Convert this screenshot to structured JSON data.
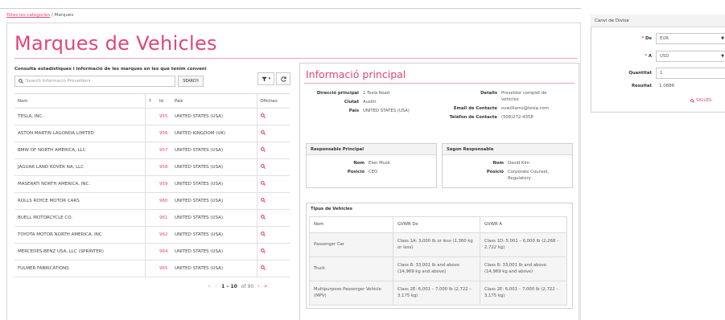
{
  "breadcrumb": {
    "root": "Totes les categories",
    "sep": " / ",
    "current": "Marques"
  },
  "page_title": "Marques de Vehicles",
  "list": {
    "subtitle": "Consulta estadístiques i informació de les marques en les que tenim conveni",
    "search_placeholder": "Search Informació Proveïdors",
    "search_button": "SEARCH",
    "filter_label": "▾",
    "columns": {
      "name": "Nom",
      "sort": "↑",
      "id": "Id",
      "country": "País",
      "offices": "Oficines"
    },
    "rows": [
      {
        "name": "TESLA, INC.",
        "id": "955",
        "country": "UNITED STATES (USA)"
      },
      {
        "name": "ASTON MARTIN LAGONDA LIMITED",
        "id": "956",
        "country": "UNITED KINGDOM (UK)"
      },
      {
        "name": "BMW OF NORTH AMERICA, LLC",
        "id": "957",
        "country": "UNITED STATES (USA)"
      },
      {
        "name": "JAGUAR LAND ROVER NA, LLC",
        "id": "958",
        "country": "UNITED STATES (USA)"
      },
      {
        "name": "MASERATI NORTH AMERICA, INC.",
        "id": "959",
        "country": "UNITED STATES (USA)"
      },
      {
        "name": "ROLLS ROYCE MOTOR CARS",
        "id": "960",
        "country": "UNITED STATES (USA)"
      },
      {
        "name": "BUELL MOTORCYCLE CO.",
        "id": "961",
        "country": "UNITED STATES (USA)"
      },
      {
        "name": "TOYOTA MOTOR NORTH AMERICA, INC",
        "id": "962",
        "country": "UNITED STATES (USA)"
      },
      {
        "name": "MERCEDES-BENZ USA, LLC (SPRINTER)",
        "id": "964",
        "country": "UNITED STATES (USA)"
      },
      {
        "name": "FULMER FABRICATIONS",
        "id": "965",
        "country": "UNITED STATES (USA)"
      }
    ],
    "pager": {
      "range": "1 – 10",
      "of": "of 90"
    }
  },
  "detail": {
    "title": "Informació principal",
    "left": [
      {
        "k": "Direcció principal",
        "v": "1 Tesla Road"
      },
      {
        "k": "Ciutat",
        "v": "Austin"
      },
      {
        "k": "País",
        "v": "UNITED STATES (USA)"
      }
    ],
    "right": [
      {
        "k": "Detalls",
        "v": "Proveïdor complet de vehicles"
      },
      {
        "k": "Email de Contacte",
        "v": "evwilliams@tesla.com"
      },
      {
        "k": "Telèfon de Contacte",
        "v": "(508)272-4358"
      }
    ],
    "resp1": {
      "header": "Responsable Principal",
      "name_k": "Nom",
      "name_v": "Elon Musk",
      "pos_k": "Posició",
      "pos_v": "CEO"
    },
    "resp2": {
      "header": "Segon Responsable",
      "name_k": "Nom",
      "name_v": "David Kim",
      "pos_k": "Posició",
      "pos_v": "Corporate Counsel, Regulatory"
    },
    "types": {
      "header": "Tipus de Vehicles",
      "columns": [
        "Nom",
        "GVWR De",
        "GVWR A"
      ],
      "rows": [
        [
          "Passenger Car",
          "Class 1A: 3,000 lb or less (1,360 kg or less)",
          "Class 1D: 5,001 – 6,000 lb (2,268 – 2,722 kg)"
        ],
        [
          "Truck",
          "Class 8: 33,001 lb and above (14,969 kg and above)",
          "Class 8: 33,001 lb and above (14,969 kg and above)"
        ],
        [
          "Multipurpose Passenger Vehicle (MPV)",
          "Class 2E: 6,001 – 7,000 lb (2,722 – 3,175 kg)",
          "Class 2E: 6,001 – 7,000 lb (2,722 – 3,175 kg)"
        ]
      ]
    }
  },
  "currency": {
    "header": "Canvi de Divisa",
    "from_label": "De",
    "from_value": "EUR",
    "to_label": "A",
    "to_value": "USD",
    "qty_label": "Quantitat",
    "qty_value": "1",
    "result_label": "Resultat",
    "result_value": "1.0886",
    "more_link": "SIGLES"
  },
  "colors": {
    "accent": "#e0457b"
  }
}
